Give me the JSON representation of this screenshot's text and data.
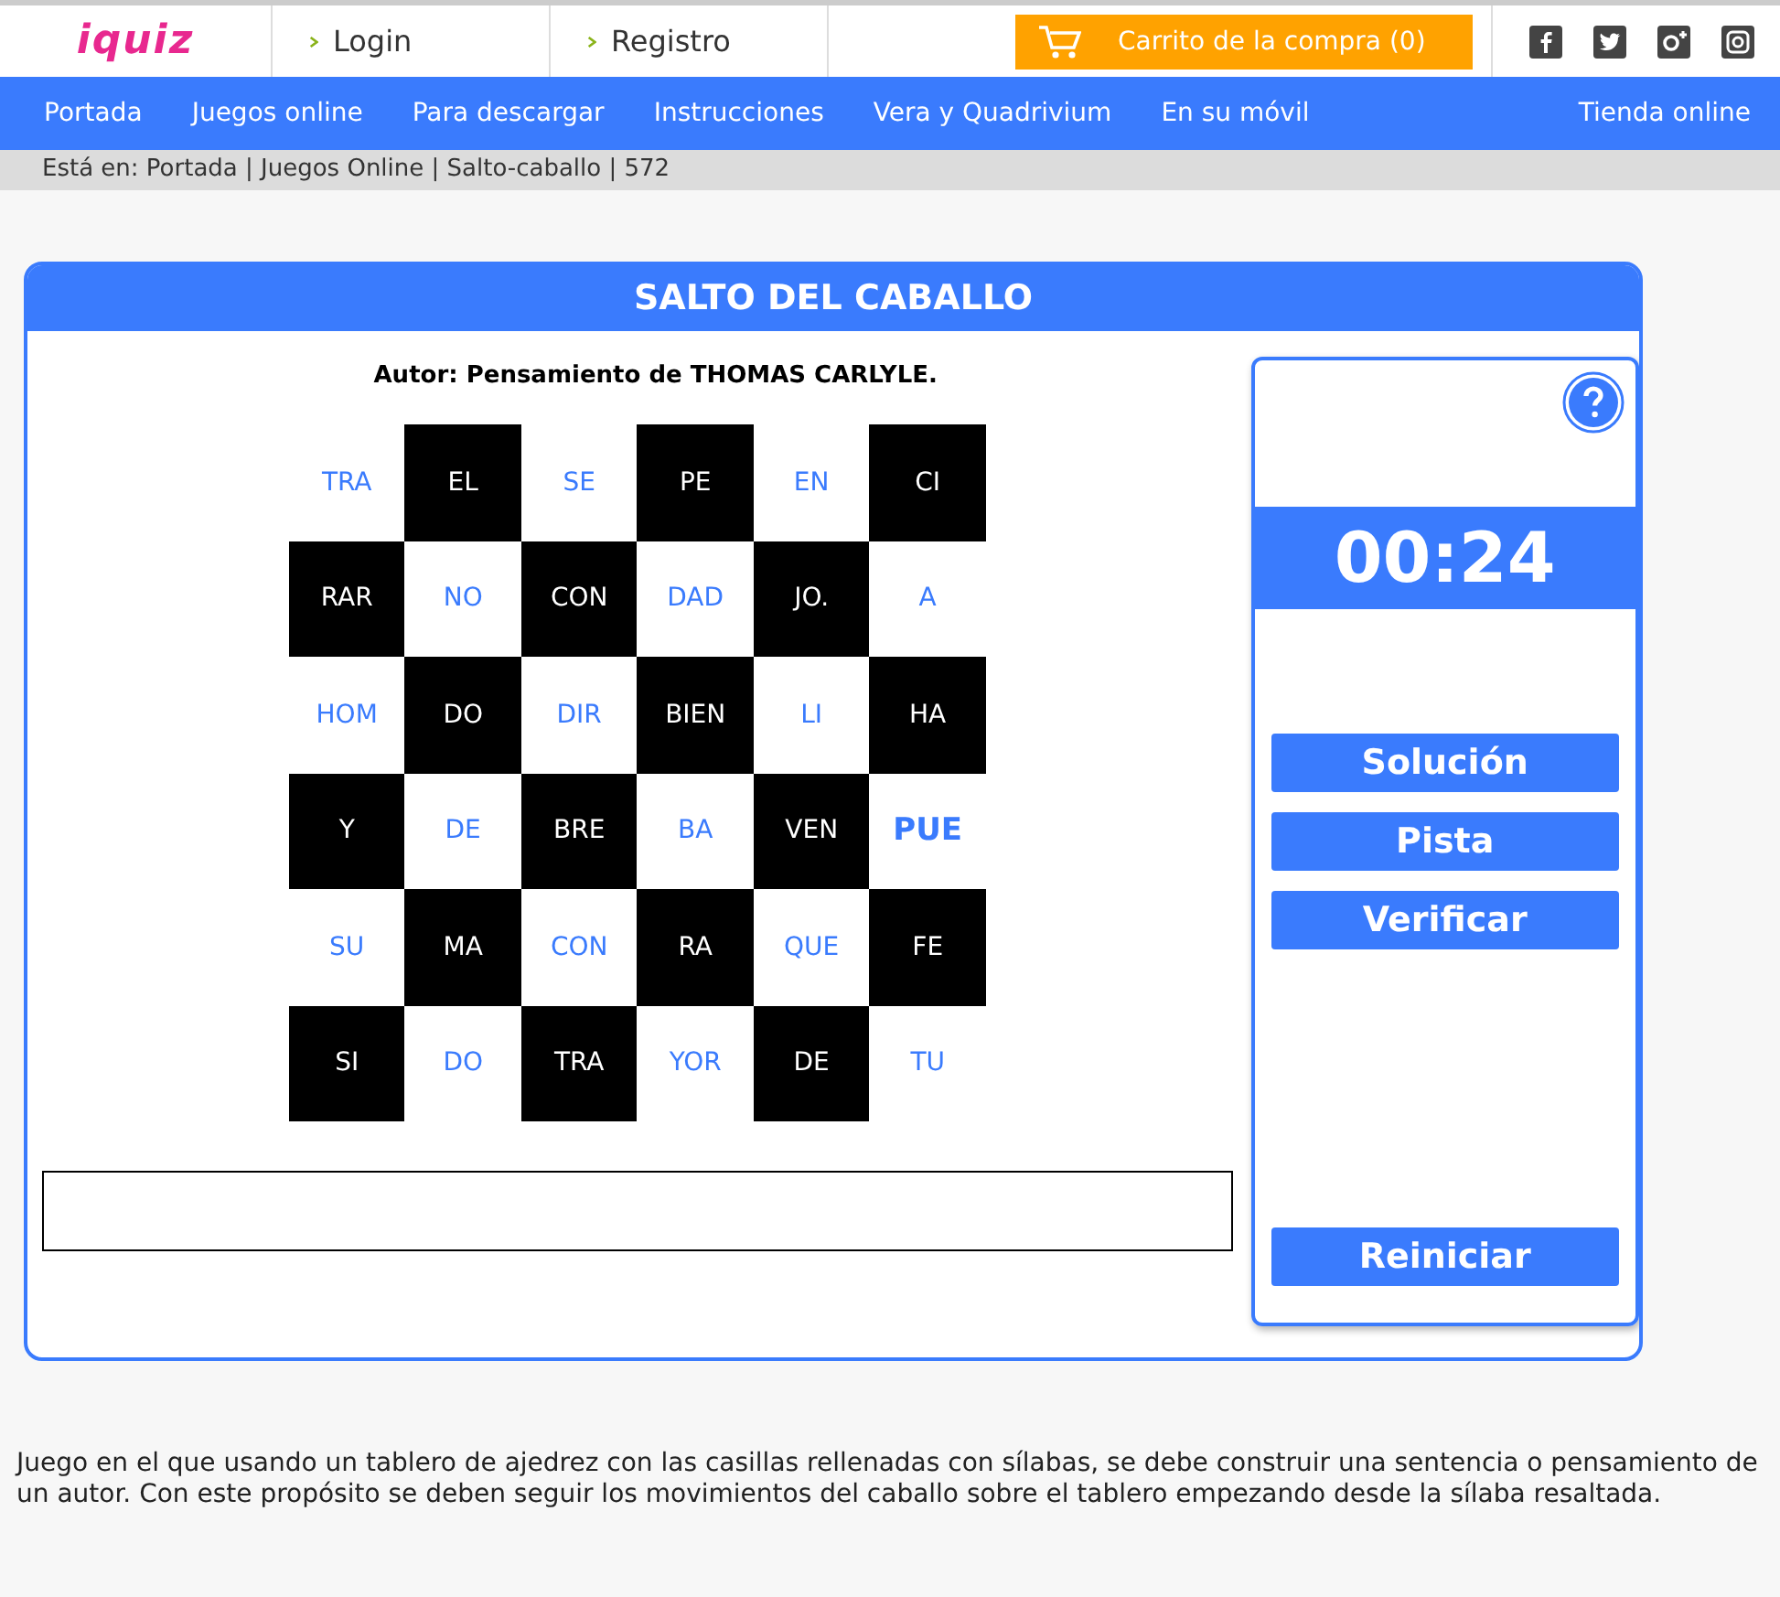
{
  "header": {
    "logo": "iquiz",
    "links": [
      "Login",
      "Registro"
    ],
    "cart": "Carrito de la compra (0)"
  },
  "nav": {
    "items": [
      "Portada",
      "Juegos online",
      "Para descargar",
      "Instrucciones",
      "Vera y Quadrivium",
      "En su móvil"
    ],
    "right": "Tienda online"
  },
  "breadcrumb": "Está en: Portada | Juegos Online | Salto-caballo | 572",
  "game": {
    "title": "SALTO DEL CABALLO",
    "author": "Autor: Pensamiento de THOMAS CARLYLE.",
    "board": [
      [
        {
          "text": "TRA",
          "dark": false,
          "highlighted": false
        },
        {
          "text": "EL",
          "dark": true,
          "highlighted": false
        },
        {
          "text": "SE",
          "dark": false,
          "highlighted": false
        },
        {
          "text": "PE",
          "dark": true,
          "highlighted": false
        },
        {
          "text": "EN",
          "dark": false,
          "highlighted": false
        },
        {
          "text": "CI",
          "dark": true,
          "highlighted": false
        }
      ],
      [
        {
          "text": "RAR",
          "dark": true,
          "highlighted": false
        },
        {
          "text": "NO",
          "dark": false,
          "highlighted": false
        },
        {
          "text": "CON",
          "dark": true,
          "highlighted": false
        },
        {
          "text": "DAD",
          "dark": false,
          "highlighted": false
        },
        {
          "text": "JO.",
          "dark": true,
          "highlighted": false
        },
        {
          "text": "A",
          "dark": false,
          "highlighted": false
        }
      ],
      [
        {
          "text": "HOM",
          "dark": false,
          "highlighted": false
        },
        {
          "text": "DO",
          "dark": true,
          "highlighted": false
        },
        {
          "text": "DIR",
          "dark": false,
          "highlighted": false
        },
        {
          "text": "BIEN",
          "dark": true,
          "highlighted": false
        },
        {
          "text": "LI",
          "dark": false,
          "highlighted": false
        },
        {
          "text": "HA",
          "dark": true,
          "highlighted": false
        }
      ],
      [
        {
          "text": "Y",
          "dark": true,
          "highlighted": false
        },
        {
          "text": "DE",
          "dark": false,
          "highlighted": false
        },
        {
          "text": "BRE",
          "dark": true,
          "highlighted": false
        },
        {
          "text": "BA",
          "dark": false,
          "highlighted": false
        },
        {
          "text": "VEN",
          "dark": true,
          "highlighted": false
        },
        {
          "text": "PUE",
          "dark": false,
          "highlighted": true
        }
      ],
      [
        {
          "text": "SU",
          "dark": false,
          "highlighted": false
        },
        {
          "text": "MA",
          "dark": true,
          "highlighted": false
        },
        {
          "text": "CON",
          "dark": false,
          "highlighted": false
        },
        {
          "text": "RA",
          "dark": true,
          "highlighted": false
        },
        {
          "text": "QUE",
          "dark": false,
          "highlighted": false
        },
        {
          "text": "FE",
          "dark": true,
          "highlighted": false
        }
      ],
      [
        {
          "text": "SI",
          "dark": true,
          "highlighted": false
        },
        {
          "text": "DO",
          "dark": false,
          "highlighted": false
        },
        {
          "text": "TRA",
          "dark": true,
          "highlighted": false
        },
        {
          "text": "YOR",
          "dark": false,
          "highlighted": false
        },
        {
          "text": "DE",
          "dark": true,
          "highlighted": false
        },
        {
          "text": "TU",
          "dark": false,
          "highlighted": false
        }
      ]
    ],
    "timer": "00:24",
    "buttons": [
      "Solución",
      "Pista",
      "Verificar"
    ],
    "reset": "Reiniciar"
  },
  "description": "Juego en el que usando un tablero de ajedrez con las casillas rellenadas con sílabas, se debe construir una sentencia o pensamiento de un autor. Con este propósito se deben seguir los movimientos del caballo sobre el tablero empezando desde la sílaba resaltada."
}
